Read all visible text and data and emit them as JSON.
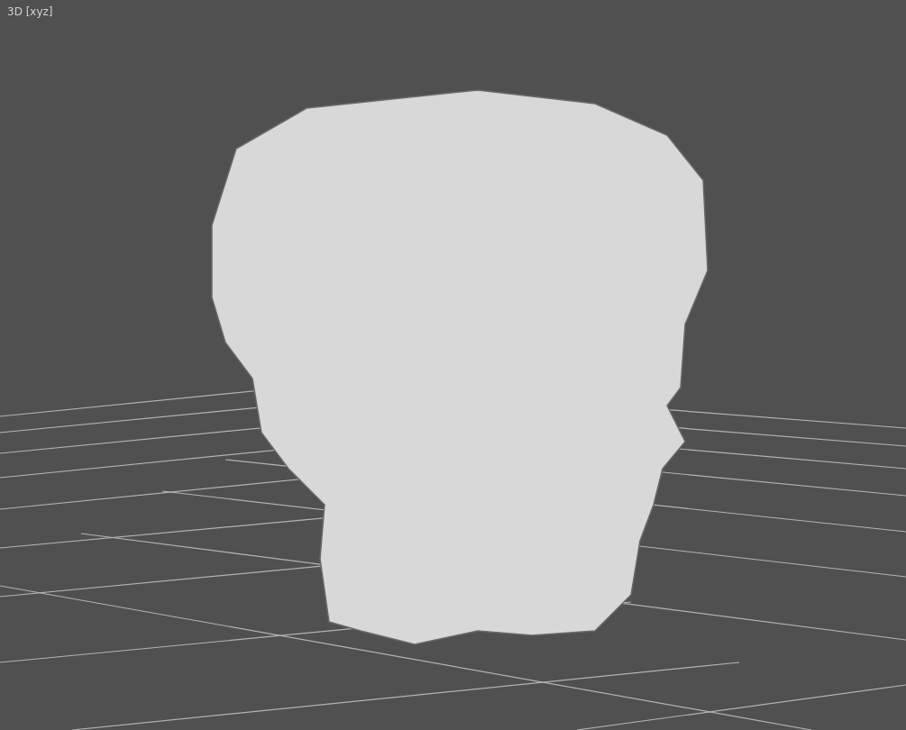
{
  "viewport": {
    "label": "3D [xyz]"
  }
}
